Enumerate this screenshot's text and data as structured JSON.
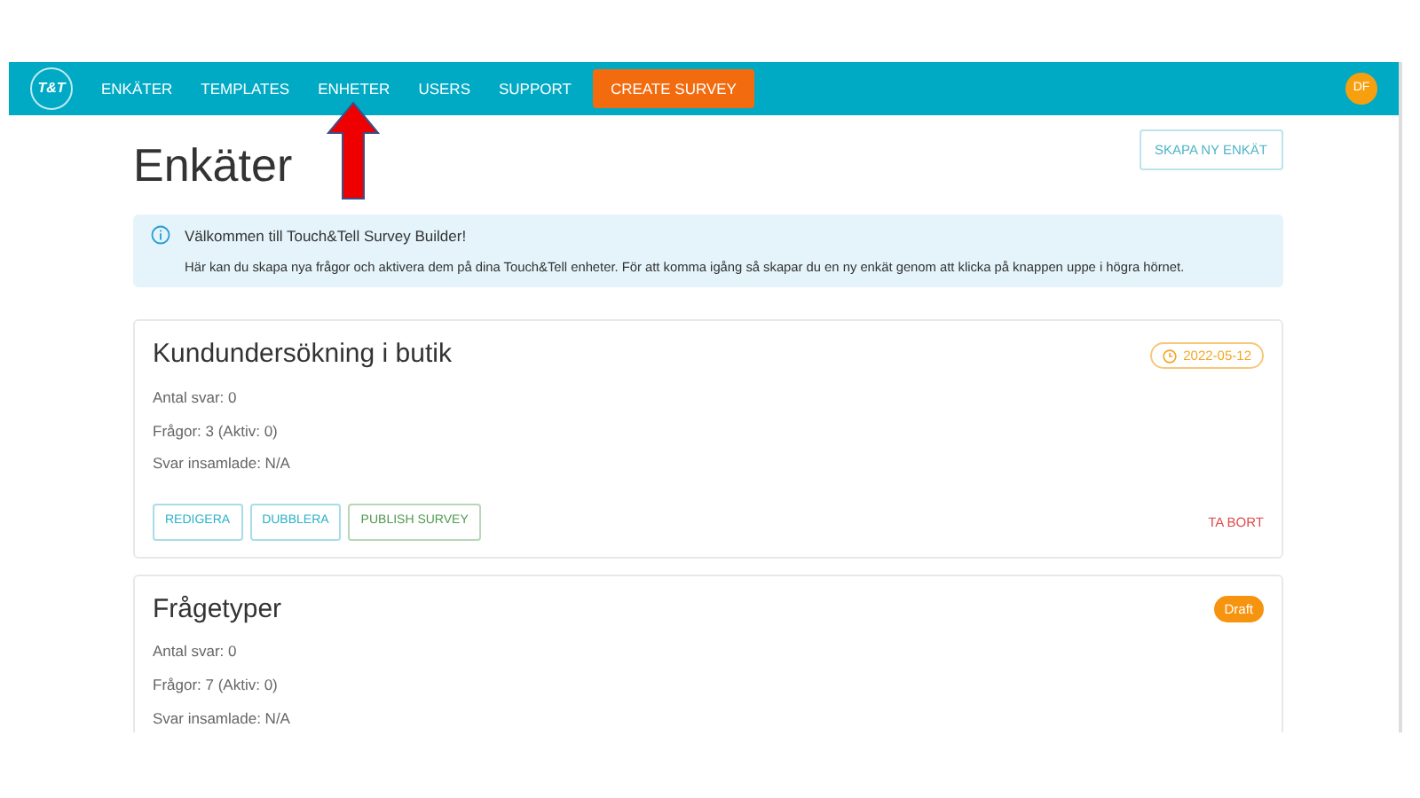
{
  "navbar": {
    "logo": "T&T",
    "items": [
      {
        "label": "ENKÄTER",
        "kind": "link"
      },
      {
        "label": "TEMPLATES",
        "kind": "link"
      },
      {
        "label": "ENHETER",
        "kind": "link"
      },
      {
        "label": "USERS",
        "kind": "link"
      },
      {
        "label": "SUPPORT",
        "kind": "link"
      },
      {
        "label": "CREATE SURVEY",
        "kind": "cta"
      }
    ],
    "avatar": "DF"
  },
  "page": {
    "title": "Enkäter",
    "create_button": "SKAPA NY ENKÄT"
  },
  "alert": {
    "title": "Välkommen till Touch&Tell Survey Builder!",
    "text": "Här kan du skapa nya frågor och aktivera dem på dina Touch&Tell enheter. För att komma igång så skapar du en ny enkät genom att klicka på knappen uppe i högra hörnet."
  },
  "surveys": [
    {
      "title": "Kundundersökning i butik",
      "badge": {
        "kind": "date",
        "text": "2022-05-12"
      },
      "stats": [
        "Antal svar: 0",
        "Frågor: 3 (Aktiv: 0)",
        "Svar insamlade: N/A"
      ],
      "actions": [
        {
          "label": "REDIGERA",
          "kind": "info"
        },
        {
          "label": "DUBBLERA",
          "kind": "info"
        },
        {
          "label": "PUBLISH SURVEY",
          "kind": "success"
        }
      ],
      "delete": "TA BORT"
    },
    {
      "title": "Frågetyper",
      "badge": {
        "kind": "draft",
        "text": "Draft"
      },
      "stats": [
        "Antal svar: 0",
        "Frågor: 7 (Aktiv: 0)",
        "Svar insamlade: N/A"
      ]
    }
  ],
  "annotation": {
    "kind": "arrow"
  }
}
